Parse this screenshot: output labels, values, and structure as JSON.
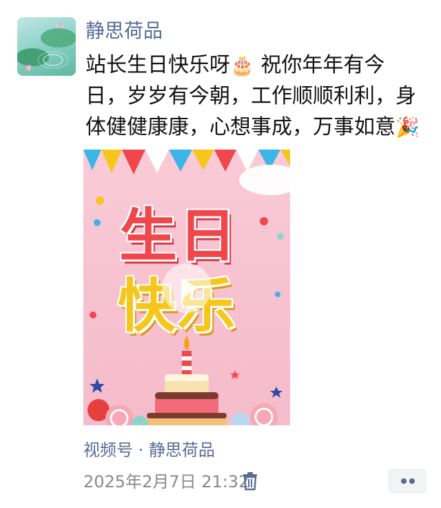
{
  "author": {
    "name": "静思荷品"
  },
  "post": {
    "line1": "站长生日快乐呀",
    "cake_emoji": "🎂",
    "line1_tail": " 祝你年年有今",
    "line2": "日，岁岁有今朝，工作顺顺利利，身",
    "line3": "体健健康康，心想事成，万事如意",
    "party_emoji": "🎉"
  },
  "video": {
    "title_top": "生日",
    "title_bottom": "快乐"
  },
  "footer": {
    "channel": "视频号 · 静思荷品",
    "timestamp": "2025年2月7日 21:32"
  },
  "icons": {
    "delete": "trash-icon",
    "more": "more-dots-icon",
    "play": "play-icon"
  },
  "colors": {
    "link": "#576b95",
    "text": "#111111",
    "meta": "#8a8a8a",
    "banner_red": "#f0474c",
    "banner_yellow": "#f6c61b",
    "video_bg": "#f7c0cf"
  }
}
